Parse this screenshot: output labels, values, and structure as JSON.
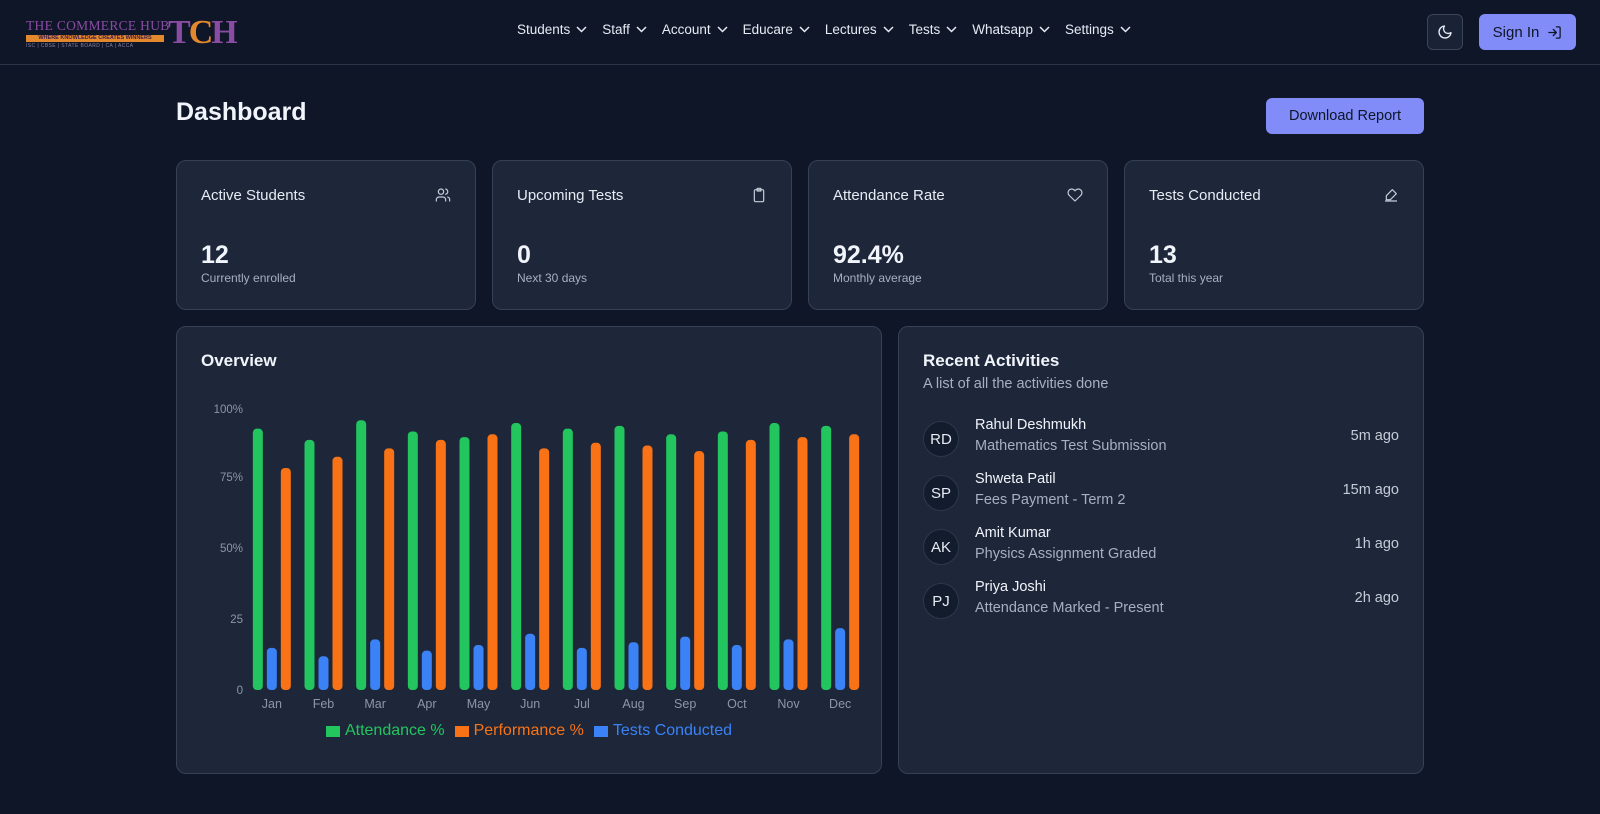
{
  "brand": {
    "line1": "THE COMMERCE HUB",
    "line2": "WHERE KNOWLEDGE CREATES WINNERS",
    "line3": "ISC | CBSE | STATE BOARD | CA | ACCA",
    "mark_t": "T",
    "mark_c": "C",
    "mark_h": "H"
  },
  "nav": {
    "items": [
      "Students",
      "Staff",
      "Account",
      "Educare",
      "Lectures",
      "Tests",
      "Whatsapp",
      "Settings"
    ]
  },
  "header": {
    "theme_icon": "moon-icon",
    "signin_label": "Sign In",
    "signin_icon": "log-in-icon"
  },
  "page": {
    "title": "Dashboard",
    "download_label": "Download Report"
  },
  "stats": [
    {
      "title": "Active Students",
      "value": "12",
      "sub": "Currently enrolled",
      "icon": "users-icon"
    },
    {
      "title": "Upcoming Tests",
      "value": "0",
      "sub": "Next 30 days",
      "icon": "clipboard-icon"
    },
    {
      "title": "Attendance Rate",
      "value": "92.4%",
      "sub": "Monthly average",
      "icon": "heart-icon"
    },
    {
      "title": "Tests Conducted",
      "value": "13",
      "sub": "Total this year",
      "icon": "pen-icon"
    }
  ],
  "overview": {
    "title": "Overview"
  },
  "chart_data": {
    "type": "bar",
    "categories": [
      "Jan",
      "Feb",
      "Mar",
      "Apr",
      "May",
      "Jun",
      "Jul",
      "Aug",
      "Sep",
      "Oct",
      "Nov",
      "Dec"
    ],
    "series": [
      {
        "name": "Attendance %",
        "color": "#22c55e",
        "values": [
          93,
          89,
          96,
          92,
          90,
          95,
          93,
          94,
          91,
          92,
          95,
          94
        ]
      },
      {
        "name": "Performance %",
        "color": "#f97316",
        "values": [
          79,
          83,
          86,
          89,
          91,
          86,
          88,
          87,
          85,
          89,
          90,
          91
        ]
      },
      {
        "name": "Tests Conducted",
        "color": "#3b82f6",
        "values": [
          15,
          12,
          18,
          14,
          16,
          20,
          15,
          17,
          19,
          16,
          18,
          22
        ]
      }
    ],
    "yticks": [
      "0",
      "25",
      "50%",
      "75%",
      "100%"
    ],
    "ylim": [
      0,
      100
    ],
    "legend": "bottom",
    "grid": false
  },
  "activities": {
    "title": "Recent Activities",
    "subtitle": "A list of all the activities done",
    "items": [
      {
        "initials": "RD",
        "name": "Rahul Deshmukh",
        "desc": "Mathematics Test Submission",
        "time": "5m ago"
      },
      {
        "initials": "SP",
        "name": "Shweta Patil",
        "desc": "Fees Payment - Term 2",
        "time": "15m ago"
      },
      {
        "initials": "AK",
        "name": "Amit Kumar",
        "desc": "Physics Assignment Graded",
        "time": "1h ago"
      },
      {
        "initials": "PJ",
        "name": "Priya Joshi",
        "desc": "Attendance Marked - Present",
        "time": "2h ago"
      }
    ]
  }
}
